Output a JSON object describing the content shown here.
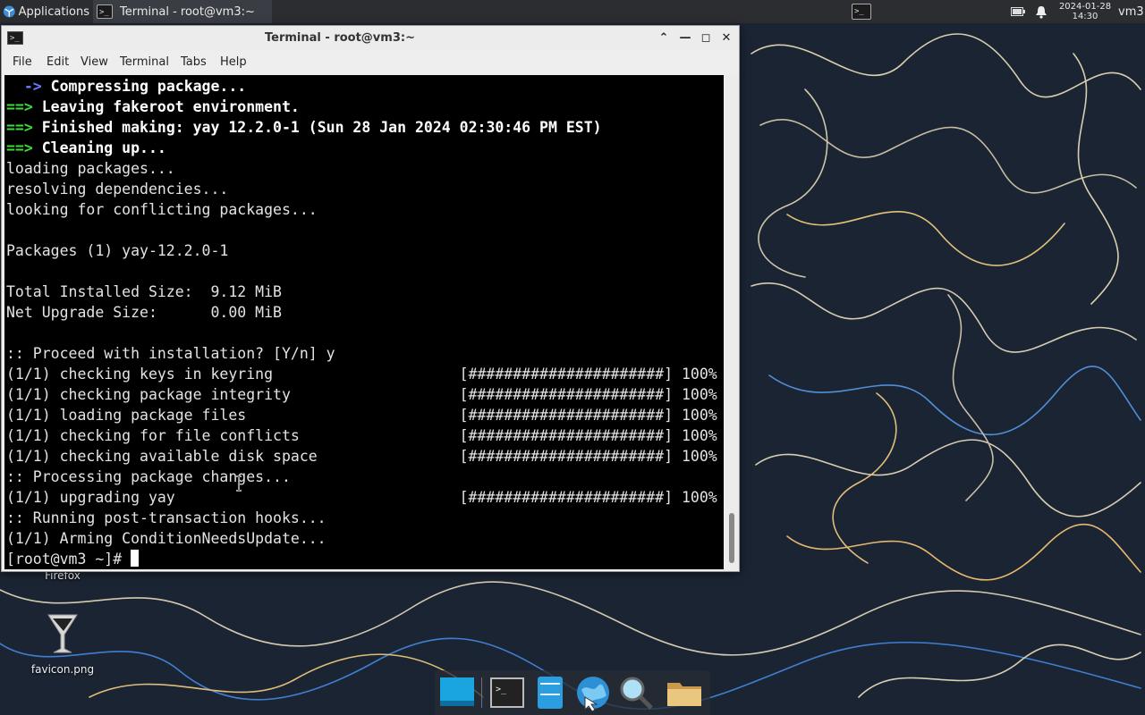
{
  "top_panel": {
    "applications_label": "Applications",
    "task_title": "Terminal - root@vm3:~",
    "date": "2024-01-28",
    "time": "14:30",
    "user": "vm3"
  },
  "window": {
    "title": "Terminal - root@vm3:~"
  },
  "menu": [
    "File",
    "Edit",
    "View",
    "Terminal",
    "Tabs",
    "Help"
  ],
  "terminal": {
    "line1_arrow": "  ->",
    "line1_text": " Compressing package...",
    "line2_arrow": "==>",
    "line2_text": " Leaving fakeroot environment.",
    "line3_arrow": "==>",
    "line3_text": " Finished making: yay 12.2.0-1 (Sun 28 Jan 2024 02:30:46 PM EST)",
    "line4_arrow": "==>",
    "line4_text": " Cleaning up...",
    "plain_lines_1": "loading packages...\nresolving dependencies...\nlooking for conflicting packages...\n\nPackages (1) yay-12.2.0-1\n\nTotal Installed Size:  9.12 MiB\nNet Upgrade Size:      0.00 MiB\n\n:: Proceed with installation? [Y/n] y\n(1/1) checking keys in keyring                     [######################] 100%\n(1/1) checking package integrity                   [######################] 100%\n(1/1) loading package files                        [######################] 100%\n(1/1) checking for file conflicts                  [######################] 100%\n(1/1) checking available disk space                [######################] 100%\n:: Processing package changes...\n(1/1) upgrading yay                                [######################] 100%\n:: Running post-transaction hooks...\n(1/1) Arming ConditionNeedsUpdate...",
    "prompt": "[root@vm3 ~]# "
  },
  "desktop": {
    "icon_firefox_label": "Firefox",
    "icon_favicon_label": "favicon.png"
  },
  "colors": {
    "arrow_green": "#3ddc3d",
    "arrow_blue": "#6d7bff",
    "terminal_bg": "#000000",
    "panel_bg": "#2b2d31"
  },
  "icons": {
    "dock": [
      "show-desktop-icon",
      "terminal-icon",
      "file-manager-icon",
      "web-browser-icon",
      "app-finder-icon",
      "folder-icon"
    ]
  }
}
